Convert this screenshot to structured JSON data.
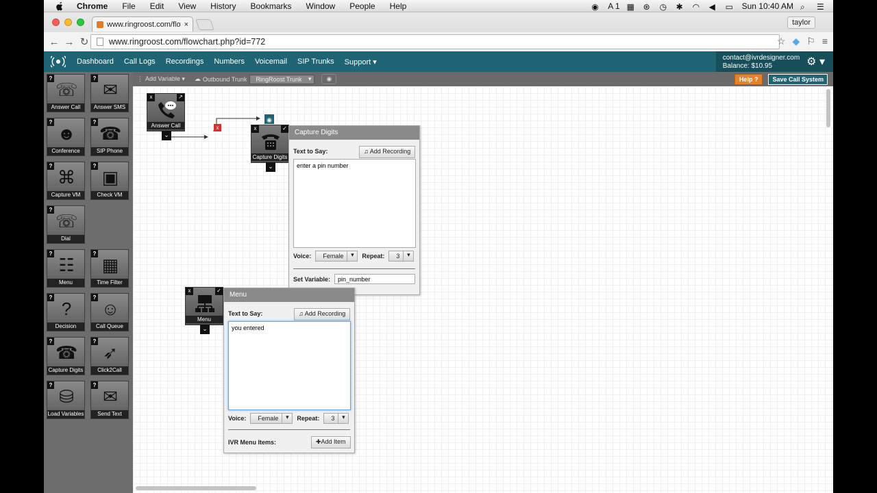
{
  "os_menu": {
    "app": "Chrome",
    "items": [
      "File",
      "Edit",
      "View",
      "History",
      "Bookmarks",
      "Window",
      "People",
      "Help"
    ],
    "status": "A 1",
    "clock": "Sun 10:40 AM"
  },
  "browser": {
    "tab_title": "www.ringroost.com/flowch",
    "tab_close": "×",
    "user": "taylor",
    "url": "www.ringroost.com/flowchart.php?id=772"
  },
  "app_nav": {
    "items": [
      "Dashboard",
      "Call Logs",
      "Recordings",
      "Numbers",
      "Voicemail",
      "SIP Trunks",
      "Support ▾"
    ],
    "email": "contact@ivrdesigner.com",
    "balance": "Balance: $10.95"
  },
  "toolbar": {
    "add_variable": "Add Variable ▾",
    "outbound_label": "Outbound Trunk",
    "trunk_value": "RingRoost Trunk",
    "help": "Help ?",
    "save": "Save Call System"
  },
  "widgets": [
    {
      "label": "Answer Call",
      "icon": "answer-call-icon"
    },
    {
      "label": "Answer SMS",
      "icon": "answer-sms-icon"
    },
    {
      "label": "Conference",
      "icon": "conference-icon"
    },
    {
      "label": "SIP Phone",
      "icon": "sip-phone-icon"
    },
    {
      "label": "Capture VM",
      "icon": "capture-vm-icon"
    },
    {
      "label": "Check VM",
      "icon": "check-vm-icon"
    },
    {
      "label": "Dial",
      "icon": "dial-icon"
    },
    {
      "label": "Menu",
      "icon": "menu-icon"
    },
    {
      "label": "Time Filter",
      "icon": "time-filter-icon"
    },
    {
      "label": "Decision",
      "icon": "decision-icon"
    },
    {
      "label": "Call Queue",
      "icon": "call-queue-icon"
    },
    {
      "label": "Capture Digits",
      "icon": "capture-digits-icon"
    },
    {
      "label": "Click2Call",
      "icon": "click2call-icon"
    },
    {
      "label": "Load Variables",
      "icon": "load-variables-icon"
    },
    {
      "label": "Send Text",
      "icon": "send-text-icon"
    }
  ],
  "nodes": {
    "answer_call": "Answer Call",
    "capture_digits": "Capture Digits",
    "menu": "Menu"
  },
  "capture_panel": {
    "title": "Capture Digits",
    "text_label": "Text to Say:",
    "add_recording": "Add Recording",
    "text": "enter a pin number",
    "voice_label": "Voice:",
    "voice": "Female",
    "repeat_label": "Repeat:",
    "repeat": "3",
    "setvar_label": "Set Variable:",
    "setvar": "pin_number"
  },
  "menu_panel": {
    "title": "Menu",
    "text_label": "Text to Say:",
    "add_recording": "Add Recording",
    "text": "you entered",
    "voice_label": "Voice:",
    "voice": "Female",
    "repeat_label": "Repeat:",
    "repeat": "3",
    "items_label": "IVR Menu Items:",
    "add_item": "Add Item"
  },
  "colors": {
    "nav": "#1f6472",
    "help": "#e5832b",
    "sidebar": "#6d6d6d"
  }
}
